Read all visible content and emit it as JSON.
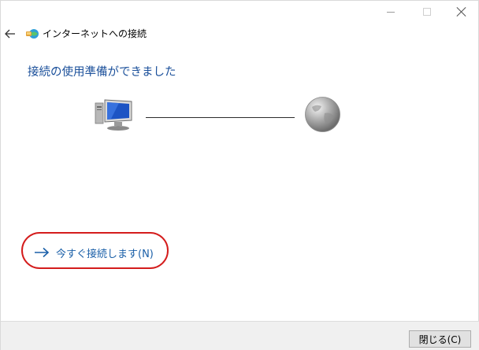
{
  "window": {
    "title": "インターネットへの接続",
    "minimize_icon": "minimize-icon",
    "maximize_icon": "maximize-icon",
    "close_icon": "close-icon"
  },
  "header": {
    "back_icon": "back-arrow-icon",
    "app_icon": "network-connection-icon"
  },
  "main": {
    "heading": "接続の使用準備ができました",
    "computer_icon": "computer-monitor-icon",
    "globe_icon": "globe-icon",
    "connect_now_label": "今すぐ接続します(N)",
    "connect_arrow_icon": "right-arrow-icon"
  },
  "footer": {
    "close_button_label": "閉じる(C)"
  },
  "colors": {
    "heading": "#1a4f9a",
    "link": "#1a5fa8",
    "highlight": "#d41c1c",
    "footer_bg": "#f0f0f0"
  }
}
